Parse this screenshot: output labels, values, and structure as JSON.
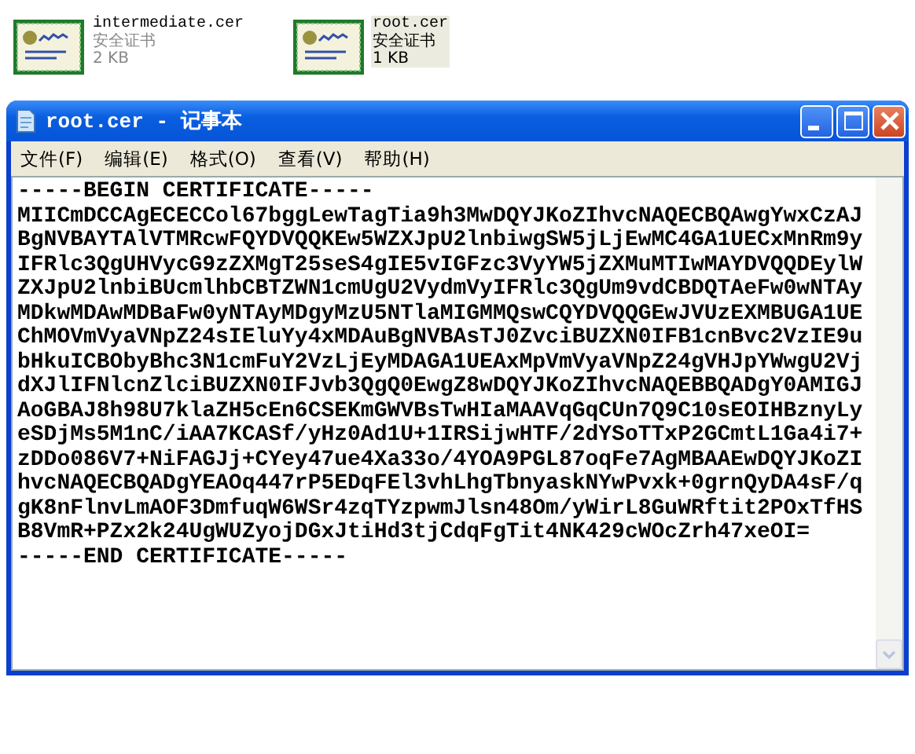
{
  "desktop_files": [
    {
      "name": "intermediate.cer",
      "type": "安全证书",
      "size": "2 KB",
      "selected": false
    },
    {
      "name": "root.cer",
      "type": "安全证书",
      "size": "1 KB",
      "selected": true
    }
  ],
  "window": {
    "title": "root.cer - 记事本"
  },
  "menu": [
    "文件(F)",
    "编辑(E)",
    "格式(O)",
    "查看(V)",
    "帮助(H)"
  ],
  "document": {
    "lines": [
      "-----BEGIN CERTIFICATE-----",
      "MIICmDCCAgECECCol67bggLewTagTia9h3MwDQYJKoZIhvcNAQECBQAwgYwxCzAJ",
      "BgNVBAYTAlVTMRcwFQYDVQQKEw5WZXJpU2lnbiwgSW5jLjEwMC4GA1UECxMnRm9y",
      "IFRlc3QgUHVycG9zZXMgT25seS4gIE5vIGFzc3VyYW5jZXMuMTIwMAYDVQQDEylW",
      "ZXJpU2lnbiBUcmlhbCBTZWN1cmUgU2VydmVyIFRlc3QgUm9vdCBDQTAeFw0wNTAy",
      "MDkwMDAwMDBaFw0yNTAyMDgyMzU5NTlaMIGMMQswCQYDVQQGEwJVUzEXMBUGA1UE",
      "ChMOVmVyaVNpZ24sIEluYy4xMDAuBgNVBAsTJ0ZvciBUZXN0IFB1cnBvc2VzIE9u",
      "bHkuICBObyBhc3N1cmFuY2VzLjEyMDAGA1UEAxMpVmVyaVNpZ24gVHJpYWwgU2Vj",
      "dXJlIFNlcnZlciBUZXN0IFJvb3QgQ0EwgZ8wDQYJKoZIhvcNAQEBBQADgY0AMIGJ",
      "AoGBAJ8h98U7klaZH5cEn6CSEKmGWVBsTwHIaMAAVqGqCUn7Q9C10sEOIHBznyLy",
      "eSDjMs5M1nC/iAA7KCASf/yHz0Ad1U+1IRSijwHTF/2dYSoTTxP2GCmtL1Ga4i7+",
      "zDDo086V7+NiFAGJj+CYey47ue4Xa33o/4YOA9PGL87oqFe7AgMBAAEwDQYJKoZI",
      "hvcNAQECBQADgYEAOq447rP5EDqFEl3vhLhgTbnyaskNYwPvxk+0grnQyDA4sF/q",
      "gK8nFlnvLmAOF3DmfuqW6WSr4zqTYzpwmJlsn48Om/yWirL8GuWRftit2POxTfHS",
      "B8VmR+PZx2k24UgWUZyojDGxJtiHd3tjCdqFgTit4NK429cWOcZrh47xeOI=",
      "-----END CERTIFICATE-----"
    ]
  }
}
